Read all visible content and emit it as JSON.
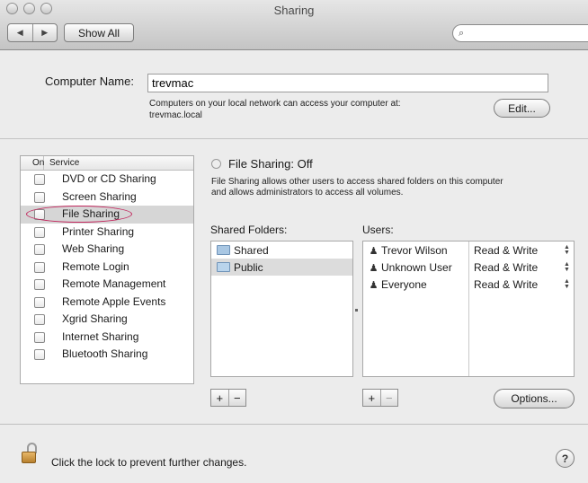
{
  "window": {
    "title": "Sharing"
  },
  "toolbar": {
    "back_glyph": "◀",
    "forward_glyph": "▶",
    "show_all_label": "Show All",
    "search_icon_glyph": "🔍",
    "search_value": ""
  },
  "computer_name": {
    "label": "Computer Name:",
    "value": "trevmac",
    "info_line1": "Computers on your local network can access your computer at:",
    "info_line2": "trevmac.local",
    "edit_label": "Edit..."
  },
  "services": {
    "header_on": "On",
    "header_service": "Service",
    "items": [
      {
        "label": "DVD or CD Sharing",
        "checked": false
      },
      {
        "label": "Screen Sharing",
        "checked": false
      },
      {
        "label": "File Sharing",
        "checked": false,
        "selected": true
      },
      {
        "label": "Printer Sharing",
        "checked": false
      },
      {
        "label": "Web Sharing",
        "checked": false
      },
      {
        "label": "Remote Login",
        "checked": false
      },
      {
        "label": "Remote Management",
        "checked": false
      },
      {
        "label": "Remote Apple Events",
        "checked": false
      },
      {
        "label": "Xgrid Sharing",
        "checked": false
      },
      {
        "label": "Internet Sharing",
        "checked": false
      },
      {
        "label": "Bluetooth Sharing",
        "checked": false
      }
    ]
  },
  "file_sharing": {
    "status": "File Sharing: Off",
    "desc_line1": "File Sharing allows other users to access shared folders on this computer",
    "desc_line2": "and allows administrators to access all volumes."
  },
  "shared_folders": {
    "label": "Shared Folders:",
    "items": [
      {
        "name": "Shared",
        "selected": false
      },
      {
        "name": "Public",
        "selected": true
      }
    ],
    "add_glyph": "+",
    "remove_glyph": "−"
  },
  "users": {
    "label": "Users:",
    "items": [
      {
        "name": "Trevor Wilson",
        "permission": "Read & Write",
        "icon": "single-user-icon"
      },
      {
        "name": "Unknown User",
        "permission": "Read & Write",
        "icon": "single-user-icon"
      },
      {
        "name": "Everyone",
        "permission": "Read & Write",
        "icon": "group-icon"
      }
    ],
    "add_glyph": "+",
    "remove_glyph": "−",
    "options_label": "Options..."
  },
  "footer": {
    "lock_text": "Click the lock to prevent further changes.",
    "help_glyph": "?"
  },
  "colors": {
    "annotation": "#c2255c",
    "selection": "#d6d6d6"
  }
}
